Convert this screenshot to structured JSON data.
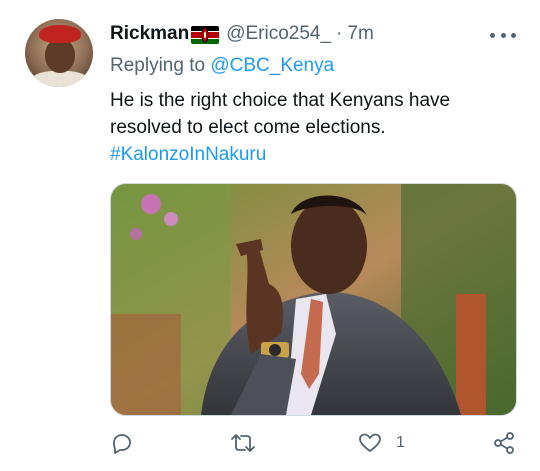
{
  "author": {
    "display_name": "Rickman",
    "flag_icon": "kenya-flag-icon",
    "handle": "@Erico254_",
    "separator": "·",
    "time": "7m"
  },
  "reply": {
    "prefix": "Replying to",
    "mention": "@CBC_Kenya"
  },
  "tweet": {
    "text": "He is the right choice that Kenyans have resolved to elect come elections.",
    "hashtag": "#KalonzoInNakuru"
  },
  "media": {
    "description": "man-pointing-photo"
  },
  "actions": {
    "reply_icon": "reply-icon",
    "retweet_icon": "retweet-icon",
    "like_icon": "heart-icon",
    "like_count": "1",
    "share_icon": "share-icon"
  },
  "colors": {
    "link": "#1d9bf0",
    "muted": "#536471",
    "text": "#0f1419"
  }
}
